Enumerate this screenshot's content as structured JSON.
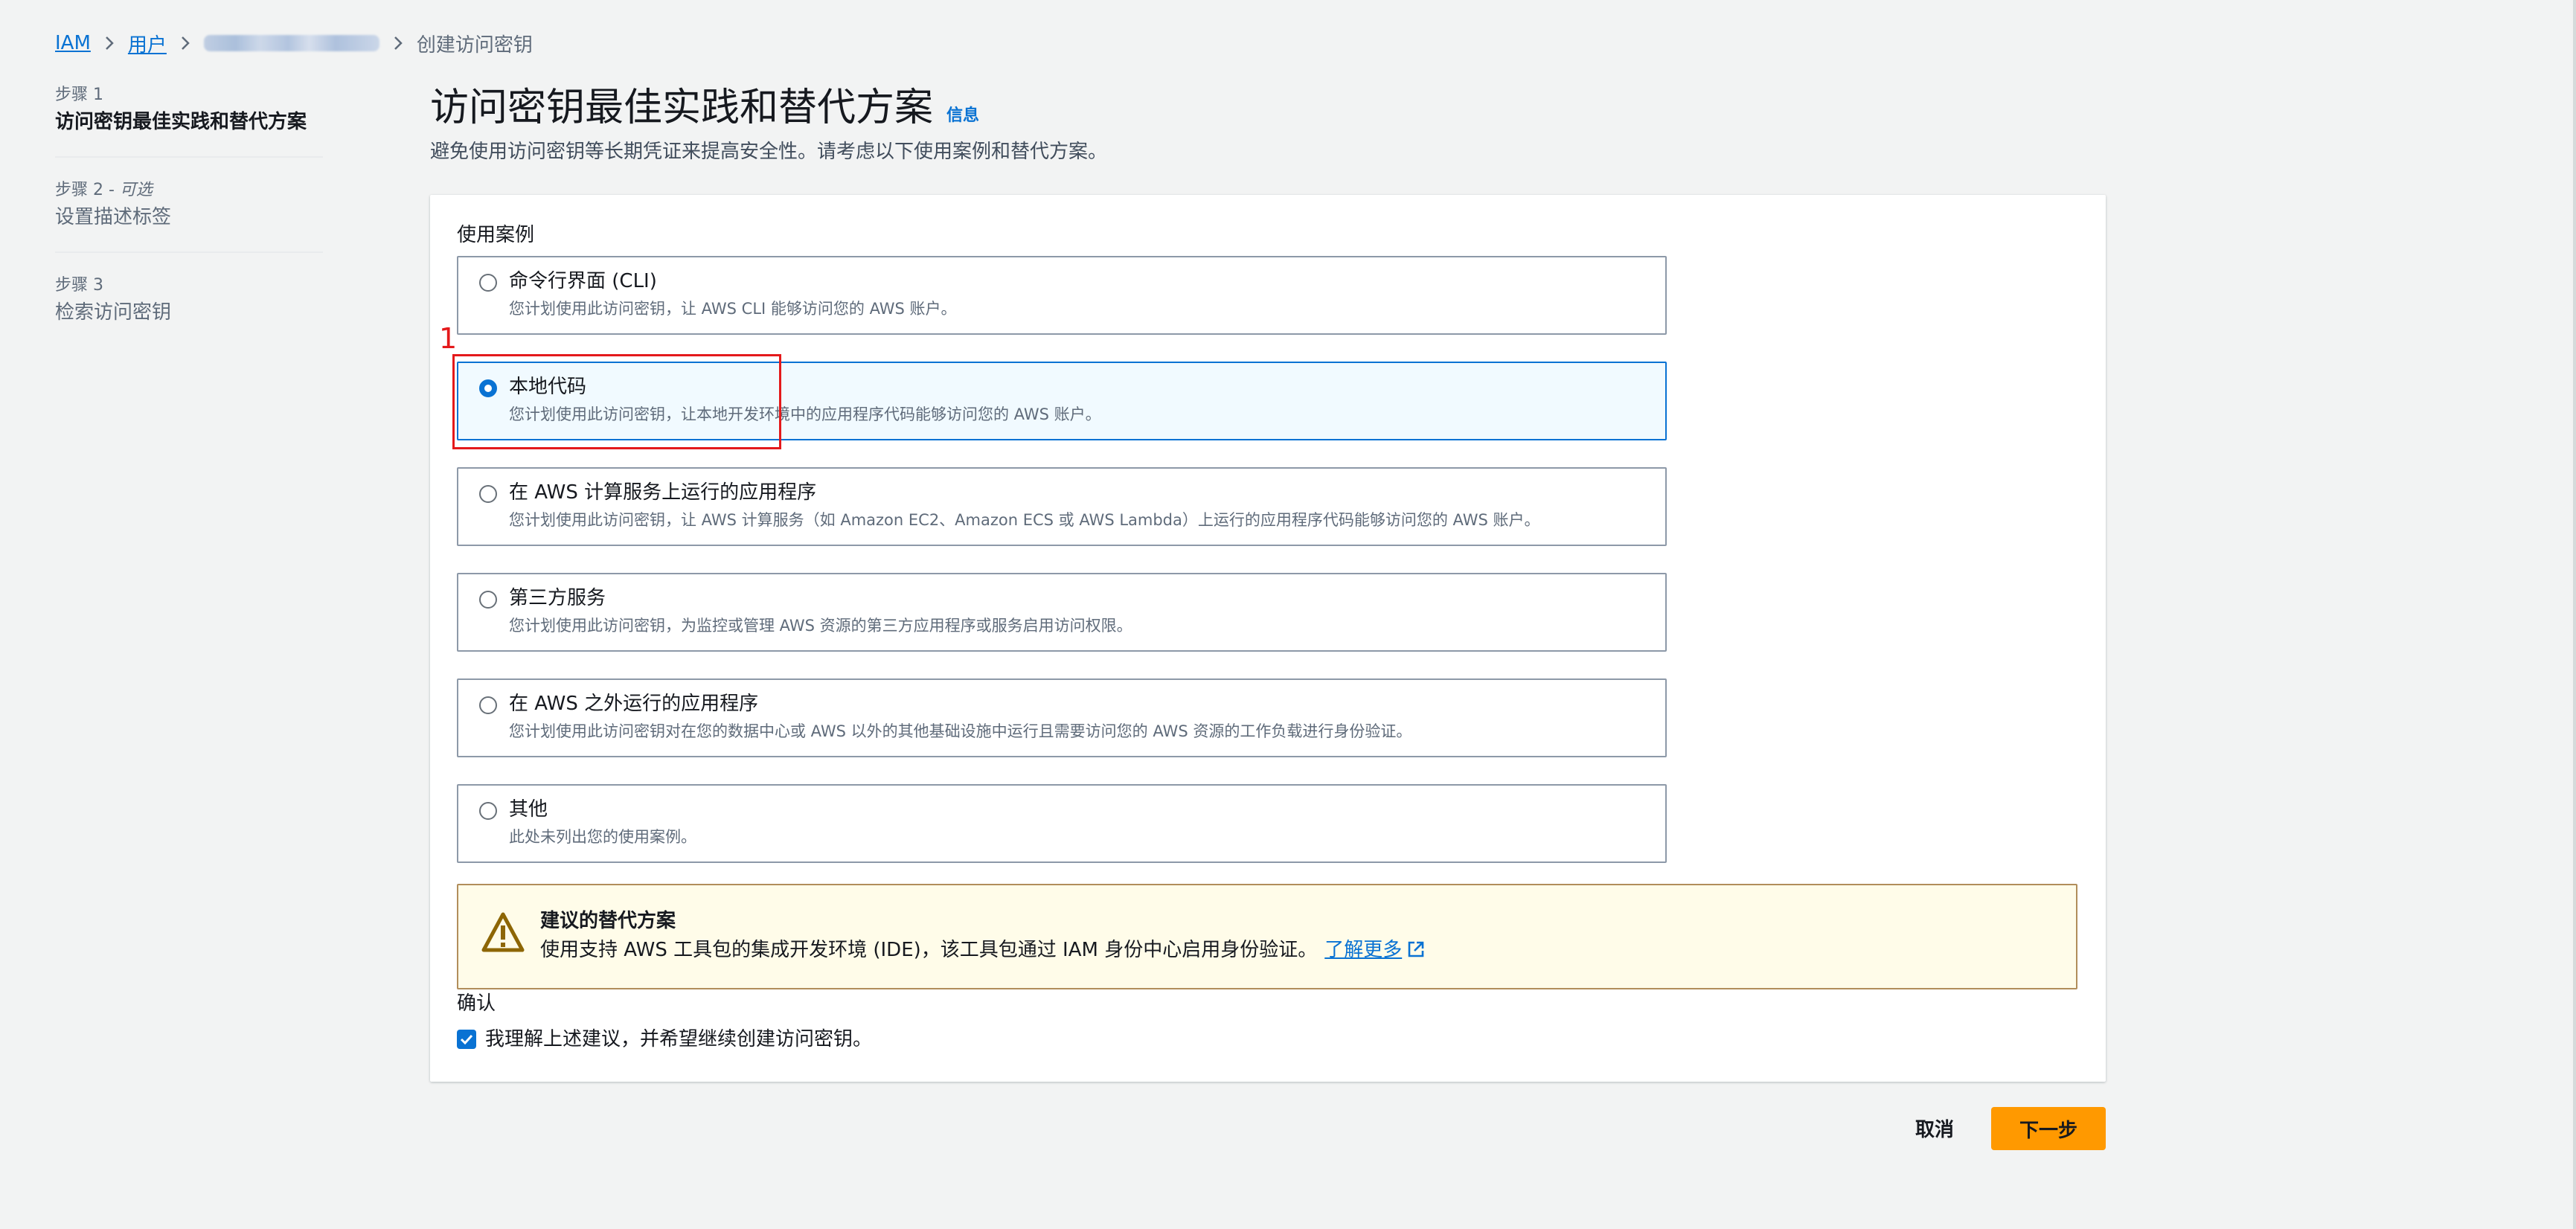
{
  "breadcrumb": {
    "iam": "IAM",
    "users": "用户",
    "current": "创建访问密钥"
  },
  "steps": [
    {
      "kicker": "步骤 1",
      "title": "访问密钥最佳实践和替代方案"
    },
    {
      "kicker": "步骤 2 - ",
      "kicker_optional": "可选",
      "title": "设置描述标签"
    },
    {
      "kicker": "步骤 3",
      "title": "检索访问密钥"
    }
  ],
  "page": {
    "title": "访问密钥最佳实践和替代方案",
    "info_link": "信息",
    "description": "避免使用访问密钥等长期凭证来提高安全性。请考虑以下使用案例和替代方案。"
  },
  "use_cases": {
    "label": "使用案例",
    "selected_index": 1,
    "options": [
      {
        "title": "命令行界面 (CLI)",
        "description": "您计划使用此访问密钥，让 AWS CLI 能够访问您的 AWS 账户。"
      },
      {
        "title": "本地代码",
        "description": "您计划使用此访问密钥，让本地开发环境中的应用程序代码能够访问您的 AWS 账户。"
      },
      {
        "title": "在 AWS 计算服务上运行的应用程序",
        "description": "您计划使用此访问密钥，让 AWS 计算服务（如 Amazon EC2、Amazon ECS 或 AWS Lambda）上运行的应用程序代码能够访问您的 AWS 账户。"
      },
      {
        "title": "第三方服务",
        "description": "您计划使用此访问密钥，为监控或管理 AWS 资源的第三方应用程序或服务启用访问权限。"
      },
      {
        "title": "在 AWS 之外运行的应用程序",
        "description": "您计划使用此访问密钥对在您的数据中心或 AWS 以外的其他基础设施中运行且需要访问您的 AWS 资源的工作负载进行身份验证。"
      },
      {
        "title": "其他",
        "description": "此处未列出您的使用案例。"
      }
    ]
  },
  "annotation": {
    "number": "1"
  },
  "alert": {
    "title": "建议的替代方案",
    "body": "使用支持 AWS 工具包的集成开发环境 (IDE)，该工具包通过 IAM 身份中心启用身份验证。",
    "link": "了解更多",
    "icon": "warning-icon"
  },
  "confirm": {
    "label": "确认",
    "checkbox_label": "我理解上述建议，并希望继续创建访问密钥。",
    "checked": true
  },
  "footer": {
    "cancel": "取消",
    "next": "下一步"
  },
  "colors": {
    "accent": "#0972d3",
    "primary_button": "#ff9900",
    "warning_bg": "#fffce9",
    "annotation": "#e4191b"
  }
}
